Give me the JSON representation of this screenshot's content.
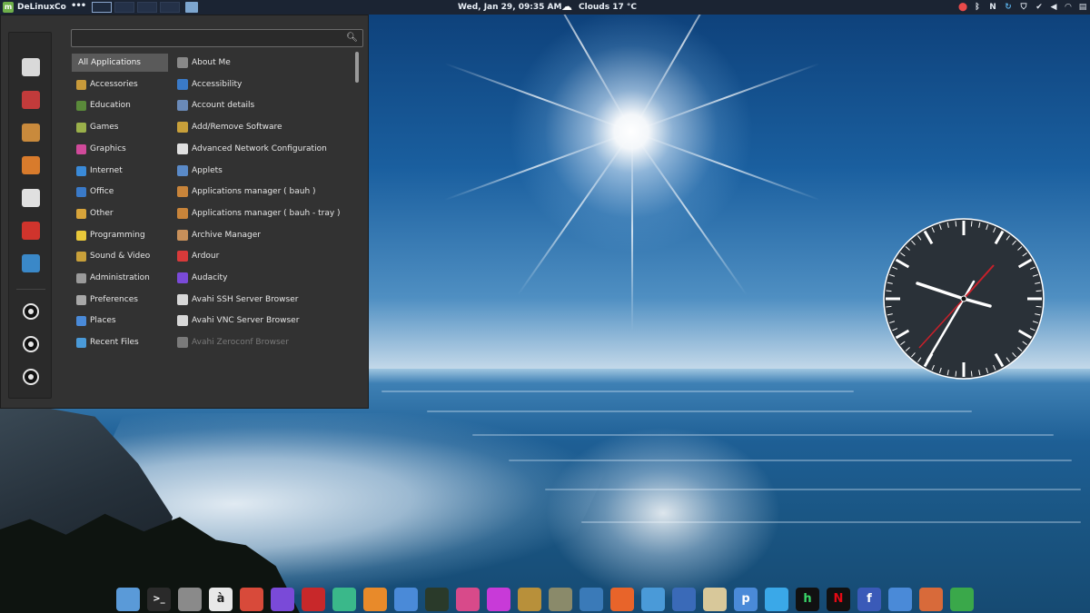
{
  "top_panel": {
    "brand": "DeLinuxCo",
    "datetime": "Wed, Jan 29, 09:35 AM",
    "weather": "Clouds 17 °C",
    "tray_icons": [
      "location-icon",
      "bluetooth-icon",
      "sync-icon",
      "n-icon",
      "shield-icon",
      "check-shield-icon",
      "volume-icon",
      "wifi-icon",
      "notes-icon"
    ]
  },
  "menu": {
    "search": {
      "value": "",
      "placeholder": ""
    },
    "favorites": [
      {
        "icon": "search-tool-icon",
        "color": "#d9d9d9"
      },
      {
        "icon": "vivaldi-icon",
        "color": "#c23b3b"
      },
      {
        "icon": "package-icon",
        "color": "#c98a3c"
      },
      {
        "icon": "box-eye-icon",
        "color": "#d87b2c"
      },
      {
        "icon": "tasks-icon",
        "color": "#e0e0e0"
      },
      {
        "icon": "font-editor-icon",
        "color": "#d0342c"
      },
      {
        "icon": "cube-e-icon",
        "color": "#3a88c8"
      }
    ],
    "categories": [
      {
        "label": "All Applications",
        "icon": "",
        "color": ""
      },
      {
        "label": "Accessories",
        "icon": "accessories-icon",
        "color": "#c89a3a"
      },
      {
        "label": "Education",
        "icon": "education-icon",
        "color": "#5a8a3a"
      },
      {
        "label": "Games",
        "icon": "games-icon",
        "color": "#9ab04a"
      },
      {
        "label": "Graphics",
        "icon": "graphics-icon",
        "color": "#d04a9a"
      },
      {
        "label": "Internet",
        "icon": "internet-icon",
        "color": "#3a8ad8"
      },
      {
        "label": "Office",
        "icon": "office-icon",
        "color": "#3a7ac8"
      },
      {
        "label": "Other",
        "icon": "other-icon",
        "color": "#d8a43a"
      },
      {
        "label": "Programming",
        "icon": "programming-icon",
        "color": "#e8c83a"
      },
      {
        "label": "Sound & Video",
        "icon": "sound-video-icon",
        "color": "#c8a03a"
      },
      {
        "label": "Administration",
        "icon": "administration-icon",
        "color": "#9a9a9a"
      },
      {
        "label": "Preferences",
        "icon": "preferences-icon",
        "color": "#a8a8a8"
      },
      {
        "label": "Places",
        "icon": "places-icon",
        "color": "#4a8ad8"
      },
      {
        "label": "Recent Files",
        "icon": "recent-files-icon",
        "color": "#4a9ad8"
      }
    ],
    "apps": [
      {
        "label": "About Me",
        "icon": "about-me-icon",
        "color": "#888888"
      },
      {
        "label": "Accessibility",
        "icon": "accessibility-icon",
        "color": "#3a7ac8"
      },
      {
        "label": "Account details",
        "icon": "account-icon",
        "color": "#6a8ab8"
      },
      {
        "label": "Add/Remove Software",
        "icon": "software-icon",
        "color": "#c8a03a"
      },
      {
        "label": "Advanced Network Configuration",
        "icon": "network-icon",
        "color": "#e0e0e0"
      },
      {
        "label": "Applets",
        "icon": "applets-icon",
        "color": "#5a8ac8"
      },
      {
        "label": "Applications manager ( bauh )",
        "icon": "bauh-icon",
        "color": "#c8843a"
      },
      {
        "label": "Applications manager ( bauh - tray )",
        "icon": "bauh-tray-icon",
        "color": "#c8843a"
      },
      {
        "label": "Archive Manager",
        "icon": "archive-icon",
        "color": "#c8905a"
      },
      {
        "label": "Ardour",
        "icon": "ardour-icon",
        "color": "#d83a3a"
      },
      {
        "label": "Audacity",
        "icon": "audacity-icon",
        "color": "#7a4ad8"
      },
      {
        "label": "Avahi SSH Server Browser",
        "icon": "avahi-ssh-icon",
        "color": "#d8d8d8"
      },
      {
        "label": "Avahi VNC Server Browser",
        "icon": "avahi-vnc-icon",
        "color": "#d8d8d8"
      },
      {
        "label": "Avahi Zeroconf Browser",
        "icon": "avahi-zeroconf-icon",
        "color": "#7a7a7a"
      }
    ]
  },
  "dock": [
    {
      "icon": "files-icon",
      "color": "#5a9ad8",
      "glyph": ""
    },
    {
      "icon": "terminal-icon",
      "color": "#2a2a2a",
      "glyph": ">_"
    },
    {
      "icon": "calculator-icon",
      "color": "#8a8a8a",
      "glyph": ""
    },
    {
      "icon": "character-map-icon",
      "color": "#e8e8e8",
      "glyph": "à"
    },
    {
      "icon": "document-viewer-icon",
      "color": "#d84a3a",
      "glyph": ""
    },
    {
      "icon": "audio-icon",
      "color": "#7a4ad8",
      "glyph": ""
    },
    {
      "icon": "ardour-dock-icon",
      "color": "#c8282a",
      "glyph": ""
    },
    {
      "icon": "home-icon",
      "color": "#3ab88a",
      "glyph": ""
    },
    {
      "icon": "blender-icon",
      "color": "#e88a2a",
      "glyph": ""
    },
    {
      "icon": "transfer-icon",
      "color": "#4a8ad8",
      "glyph": ""
    },
    {
      "icon": "camera-icon",
      "color": "#2a3a2a",
      "glyph": ""
    },
    {
      "icon": "shotwell-icon",
      "color": "#d84a8a",
      "glyph": ""
    },
    {
      "icon": "color-wheel-icon",
      "color": "#c83ad8",
      "glyph": ""
    },
    {
      "icon": "gimp-icon",
      "color": "#b8903a",
      "glyph": ""
    },
    {
      "icon": "inkscape-icon",
      "color": "#8a8a6a",
      "glyph": ""
    },
    {
      "icon": "globe-icon",
      "color": "#3a7ab8",
      "glyph": ""
    },
    {
      "icon": "firefox-icon",
      "color": "#e8642a",
      "glyph": ""
    },
    {
      "icon": "chromium-icon",
      "color": "#4a9ad8",
      "glyph": ""
    },
    {
      "icon": "thunderbird-icon",
      "color": "#3a6ab8",
      "glyph": ""
    },
    {
      "icon": "mail-icon",
      "color": "#d8c89a",
      "glyph": ""
    },
    {
      "icon": "pidgin-icon",
      "color": "#4a8ad8",
      "glyph": "p"
    },
    {
      "icon": "twitter-icon",
      "color": "#3aa8e8",
      "glyph": ""
    },
    {
      "icon": "h-icon",
      "color": "#111111",
      "glyph": "h"
    },
    {
      "icon": "netflix-icon",
      "color": "#111111",
      "glyph": "N"
    },
    {
      "icon": "facebook-icon",
      "color": "#3a5ab8",
      "glyph": "f"
    },
    {
      "icon": "writer-icon",
      "color": "#4a8ad8",
      "glyph": ""
    },
    {
      "icon": "impress-icon",
      "color": "#d86a3a",
      "glyph": ""
    },
    {
      "icon": "calc-icon",
      "color": "#3aa84a",
      "glyph": ""
    }
  ]
}
